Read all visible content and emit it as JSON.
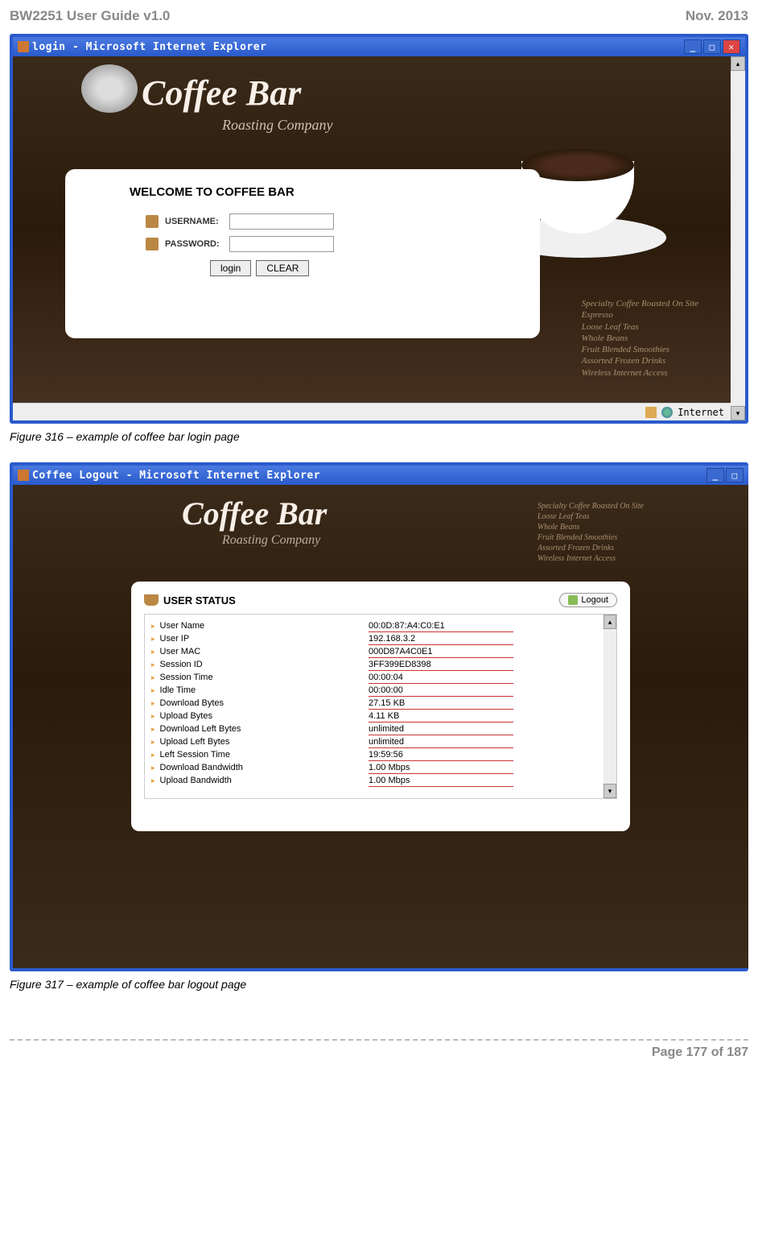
{
  "doc_header_left": "BW2251 User Guide v1.0",
  "doc_header_right": "Nov.  2013",
  "login_window": {
    "title": "login - Microsoft Internet Explorer",
    "brand": "Coffee Bar",
    "brand_sub": "Roasting Company",
    "welcome": "WELCOME TO COFFEE BAR",
    "username_label": "USERNAME:",
    "password_label": "PASSWORD:",
    "login_btn": "login",
    "clear_btn": "CLEAR",
    "status_text": "Internet"
  },
  "figure316": "Figure 316  – example of coffee bar login page",
  "logout_window": {
    "title": "Coffee Logout - Microsoft Internet Explorer",
    "brand": "Coffee Bar",
    "brand_sub": "Roasting Company",
    "status_title": "USER STATUS",
    "logout_btn": "Logout",
    "rows": [
      {
        "label": "User Name",
        "value": "00:0D:87:A4:C0:E1"
      },
      {
        "label": "User IP",
        "value": "192.168.3.2"
      },
      {
        "label": "User MAC",
        "value": "000D87A4C0E1"
      },
      {
        "label": "Session ID",
        "value": "3FF399ED8398"
      },
      {
        "label": "Session Time",
        "value": "00:00:04"
      },
      {
        "label": "Idle Time",
        "value": "00:00:00"
      },
      {
        "label": "Download Bytes",
        "value": "27.15 KB"
      },
      {
        "label": "Upload Bytes",
        "value": "4.11 KB"
      },
      {
        "label": "Download Left Bytes",
        "value": "unlimited"
      },
      {
        "label": "Upload Left Bytes",
        "value": "unlimited"
      },
      {
        "label": "Left Session Time",
        "value": "19:59:56"
      },
      {
        "label": "Download Bandwidth",
        "value": "1.00 Mbps"
      },
      {
        "label": "Upload Bandwidth",
        "value": "1.00 Mbps"
      }
    ]
  },
  "figure317": "Figure 317  – example of coffee bar logout page",
  "page_footer": "Page 177 of 187"
}
